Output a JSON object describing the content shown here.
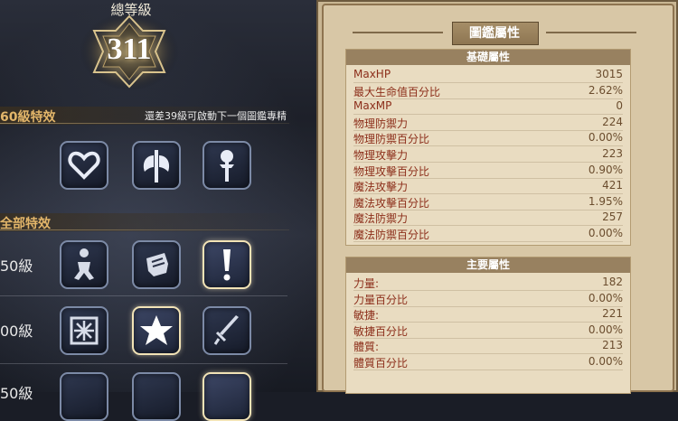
{
  "header": {
    "total_level_label": "總等級",
    "total_level": "311"
  },
  "left": {
    "section_60_label": "60級特效",
    "hint": "還差39級可啟動下一個圖鑑專精",
    "section_all_label": "全部特效",
    "row_labels": [
      "50級",
      "00級",
      "50級"
    ],
    "icons": {
      "row1": [
        "heart-icon",
        "double-axe-icon",
        "scepter-icon"
      ],
      "row2": [
        "running-figure-icon",
        "fist-icon",
        "exclamation-icon"
      ],
      "row3": [
        "snowflake-icon",
        "star-icon",
        "dagger-icon"
      ]
    }
  },
  "panel": {
    "title": "圖鑑屬性",
    "basic": {
      "header": "基礎屬性",
      "rows": [
        {
          "k": "MaxHP",
          "v": "3015"
        },
        {
          "k": "最大生命值百分比",
          "v": "2.62%"
        },
        {
          "k": "MaxMP",
          "v": "0"
        },
        {
          "k": "物理防禦力",
          "v": "224"
        },
        {
          "k": "物理防禦百分比",
          "v": "0.00%"
        },
        {
          "k": "物理攻擊力",
          "v": "223"
        },
        {
          "k": "物理攻擊百分比",
          "v": "0.90%"
        },
        {
          "k": "魔法攻擊力",
          "v": "421"
        },
        {
          "k": "魔法攻擊百分比",
          "v": "1.95%"
        },
        {
          "k": "魔法防禦力",
          "v": "257"
        },
        {
          "k": "魔法防禦百分比",
          "v": "0.00%"
        }
      ]
    },
    "main": {
      "header": "主要屬性",
      "rows": [
        {
          "k": "力量:",
          "v": "182"
        },
        {
          "k": "力量百分比",
          "v": "0.00%"
        },
        {
          "k": "敏捷:",
          "v": "221"
        },
        {
          "k": "敏捷百分比",
          "v": "0.00%"
        },
        {
          "k": "體質:",
          "v": "213"
        },
        {
          "k": "體質百分比",
          "v": "0.00%"
        }
      ]
    }
  }
}
